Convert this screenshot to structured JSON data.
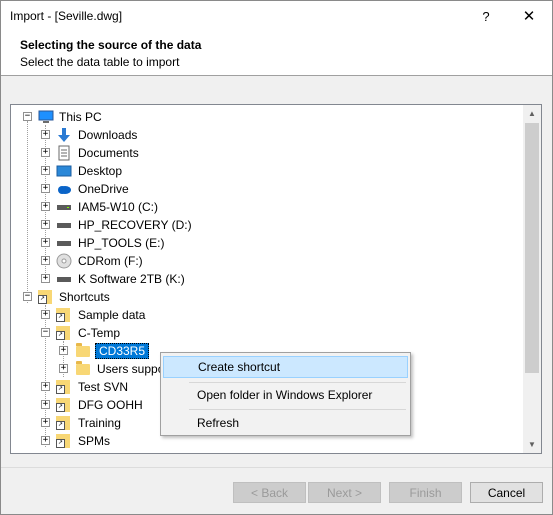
{
  "window": {
    "title": "Import - [Seville.dwg]",
    "help_label": "?",
    "close_label": "✕"
  },
  "header": {
    "title": "Selecting the source of the data",
    "subtitle": "Select the data table to import"
  },
  "tree": {
    "items": [
      {
        "label": "This PC",
        "icon": "computer-icon",
        "expander": "−"
      },
      {
        "label": "Downloads",
        "icon": "download-arrow-icon",
        "expander": "+"
      },
      {
        "label": "Documents",
        "icon": "document-icon",
        "expander": "+"
      },
      {
        "label": "Desktop",
        "icon": "desktop-icon",
        "expander": "+"
      },
      {
        "label": "OneDrive",
        "icon": "cloud-icon",
        "expander": "+"
      },
      {
        "label": "IAM5-W10 (C:)",
        "icon": "drive-icon",
        "expander": "+"
      },
      {
        "label": "HP_RECOVERY (D:)",
        "icon": "drive-icon",
        "expander": "+"
      },
      {
        "label": "HP_TOOLS (E:)",
        "icon": "drive-icon",
        "expander": "+"
      },
      {
        "label": "CDRom (F:)",
        "icon": "cd-icon",
        "expander": "+"
      },
      {
        "label": "K Software 2TB (K:)",
        "icon": "drive-icon",
        "expander": "+"
      },
      {
        "label": "Shortcuts",
        "icon": "shortcut-folder-icon",
        "expander": "−"
      },
      {
        "label": "Sample data",
        "icon": "shortcut-folder-icon",
        "expander": "+"
      },
      {
        "label": "C-Temp",
        "icon": "shortcut-folder-icon",
        "expander": "−"
      },
      {
        "label": "CD33R5",
        "icon": "folder-icon",
        "expander": "+"
      },
      {
        "label": "Users suppo",
        "icon": "folder-icon",
        "expander": "+"
      },
      {
        "label": "Test SVN",
        "icon": "shortcut-folder-icon",
        "expander": "+"
      },
      {
        "label": "DFG OOHH",
        "icon": "shortcut-folder-icon",
        "expander": "+"
      },
      {
        "label": "Training",
        "icon": "shortcut-folder-icon",
        "expander": "+"
      },
      {
        "label": "SPMs",
        "icon": "shortcut-folder-icon",
        "expander": "+"
      }
    ]
  },
  "context_menu": {
    "items": [
      {
        "label": "Create shortcut"
      },
      {
        "label": "Open folder in Windows Explorer"
      },
      {
        "label": "Refresh"
      }
    ]
  },
  "buttons": {
    "back": "< Back",
    "next": "Next >",
    "finish": "Finish",
    "cancel": "Cancel"
  },
  "colors": {
    "selection": "#0078d7",
    "menu_highlight": "#cce8ff",
    "folder": "#f8d775"
  }
}
